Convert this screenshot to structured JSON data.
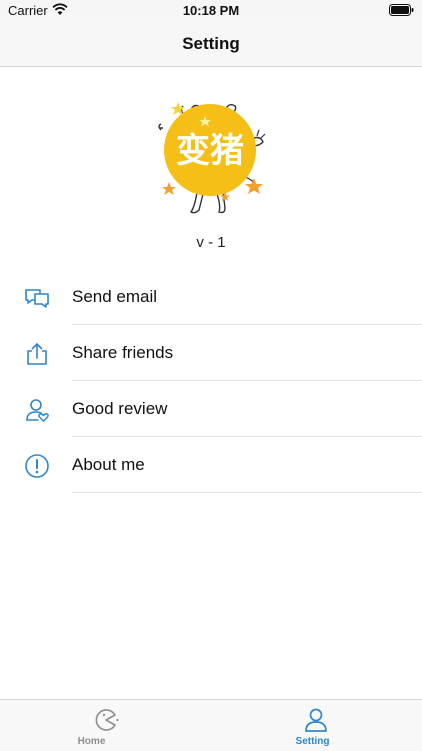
{
  "status_bar": {
    "carrier": "Carrier",
    "time": "10:18 PM"
  },
  "nav": {
    "title": "Setting"
  },
  "logo": {
    "text": "变猪"
  },
  "version": "v - 1",
  "menu": [
    {
      "label": "Send email",
      "icon": "chat-bubbles-icon"
    },
    {
      "label": "Share friends",
      "icon": "share-icon"
    },
    {
      "label": "Good review",
      "icon": "user-heart-icon"
    },
    {
      "label": "About me",
      "icon": "info-icon"
    }
  ],
  "tabbar": {
    "items": [
      {
        "label": "Home",
        "icon": "pacman-icon",
        "active": false
      },
      {
        "label": "Setting",
        "icon": "person-icon",
        "active": true
      }
    ]
  },
  "colors": {
    "accent": "#2f86c8",
    "logo_yellow": "#f5bf17",
    "star": "#f2a22b",
    "inactive": "#8e8e8e"
  }
}
